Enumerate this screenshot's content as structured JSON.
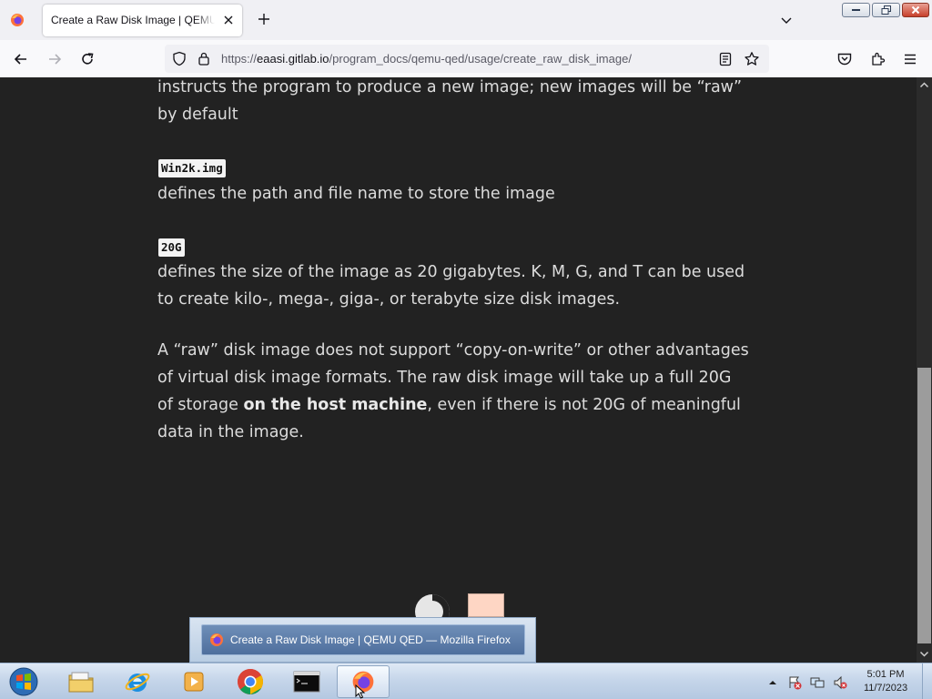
{
  "browser": {
    "tab_title": "Create a Raw Disk Image | QEMU QED",
    "url_host": "eaasi.gitlab.io",
    "url_prefix": "https://",
    "url_path": "/program_docs/qemu-qed/usage/create_raw_disk_image/"
  },
  "content": {
    "para_intro": "instructs the program to produce a new image; new images will be “raw” by default",
    "code_file": "Win2k.img",
    "para_file": "defines the path and file name to store the image",
    "code_size": "20G",
    "para_size": "defines the size of the image as 20 gigabytes. K, M, G, and T can be used to create kilo-, mega-, giga-, or terabyte size disk images.",
    "para_raw_a": "A “raw” disk image does not support “copy-on-write” or other advantages of virtual disk image formats. The raw disk image will take up a full 20G of storage ",
    "para_raw_bold": "on the host machine",
    "para_raw_b": ", even if there is not 20G of meaningful data in the image."
  },
  "taskbar": {
    "preview_title": "Create a Raw Disk Image | QEMU QED — Mozilla Firefox",
    "clock_time": "5:01 PM",
    "clock_date": "11/7/2023",
    "pinned_apps": [
      "file-explorer",
      "internet-explorer",
      "media-player",
      "chrome",
      "command-prompt",
      "firefox"
    ]
  },
  "colors": {
    "page_background": "#222222",
    "text": "#dcdcdc",
    "peach_swatch": "#fed6c4"
  }
}
